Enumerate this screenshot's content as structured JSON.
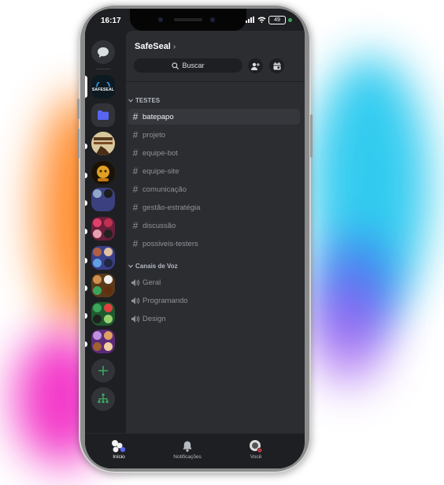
{
  "status": {
    "time": "16:17",
    "battery": "49"
  },
  "server": {
    "name": "SafeSeal",
    "logo_text": "SAFESEAL"
  },
  "search": {
    "label": "Buscar"
  },
  "categories": [
    {
      "label": "TESTES"
    },
    {
      "label": "Canais de Voz"
    }
  ],
  "text_channels": [
    {
      "name": "batepapo"
    },
    {
      "name": "projeto"
    },
    {
      "name": "equipe-bot"
    },
    {
      "name": "equipe-site"
    },
    {
      "name": "comunicação"
    },
    {
      "name": "gestão-estratégia"
    },
    {
      "name": "discussão"
    },
    {
      "name": "possiveis-testers"
    }
  ],
  "voice_channels": [
    {
      "name": "Geral"
    },
    {
      "name": "Programando"
    },
    {
      "name": "Design"
    }
  ],
  "nav": [
    {
      "label": "Início"
    },
    {
      "label": "Notificações"
    },
    {
      "label": "Você"
    }
  ],
  "colors": {
    "accent_green": "#3ba55c",
    "folder_blue": "#5865f2",
    "background": "#1e1f22",
    "panel": "#2b2d31"
  }
}
